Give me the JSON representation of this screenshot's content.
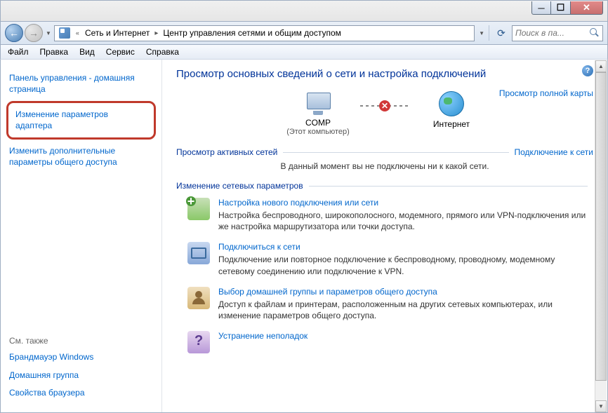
{
  "titlebar": {
    "min": "─",
    "max": "☐",
    "close": "✕"
  },
  "nav": {
    "back": "←",
    "forward": "→",
    "breadcrumb": {
      "level1": "Сеть и Интернет",
      "level2": "Центр управления сетями и общим доступом"
    },
    "refresh": "↻",
    "search_placeholder": "Поиск в па..."
  },
  "menu": {
    "file": "Файл",
    "edit": "Правка",
    "view": "Вид",
    "service": "Сервис",
    "help": "Справка"
  },
  "sidebar": {
    "home": "Панель управления - домашняя страница",
    "adapters": "Изменение параметров адаптера",
    "sharing": "Изменить дополнительные параметры общего доступа",
    "seealso_label": "См. также",
    "firewall": "Брандмауэр Windows",
    "homegroup": "Домашняя группа",
    "browser": "Свойства браузера"
  },
  "main": {
    "heading": "Просмотр основных сведений о сети и настройка подключений",
    "map": {
      "comp_name": "COMP",
      "comp_sub": "(Этот компьютер)",
      "internet": "Интернет",
      "fullmap": "Просмотр полной карты"
    },
    "active": {
      "title": "Просмотр активных сетей",
      "action": "Подключение к сети",
      "message": "В данный момент вы не подключены ни к какой сети."
    },
    "change_title": "Изменение сетевых параметров",
    "settings": [
      {
        "title": "Настройка нового подключения или сети",
        "desc": "Настройка беспроводного, широкополосного, модемного, прямого или VPN-подключения или же настройка маршрутизатора или точки доступа."
      },
      {
        "title": "Подключиться к сети",
        "desc": "Подключение или повторное подключение к беспроводному, проводному, модемному сетевому соединению или подключение к VPN."
      },
      {
        "title": "Выбор домашней группы и параметров общего доступа",
        "desc": "Доступ к файлам и принтерам, расположенным на других сетевых компьютерах, или изменение параметров общего доступа."
      },
      {
        "title": "Устранение неполадок",
        "desc": ""
      }
    ]
  }
}
